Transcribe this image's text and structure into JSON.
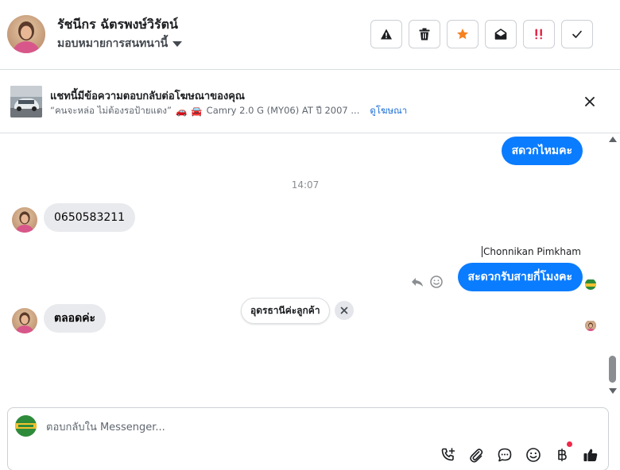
{
  "header": {
    "contact_name": "รัชนีกร ฉัตรพงษ์วิรัตน์",
    "assign_label": "มอบหมายการสนทนานี้",
    "actions": [
      {
        "name": "report-button",
        "icon": "warning-icon"
      },
      {
        "name": "delete-button",
        "icon": "trash-icon"
      },
      {
        "name": "star-button",
        "icon": "star-icon"
      },
      {
        "name": "mark-unread-button",
        "icon": "envelope-open-icon"
      },
      {
        "name": "follow-up-button",
        "icon": "double-exclamation-icon"
      },
      {
        "name": "mark-done-button",
        "icon": "checkmark-icon"
      }
    ]
  },
  "ad": {
    "title": "แชทนี้มีข้อความตอบกลับต่อโฆษณาของคุณ",
    "quote": "“คนจะหล่อ ไม่ต้องรอป้ายแดง”",
    "emoji_1": "🚗",
    "emoji_2": "🚘",
    "car_text": "Camry 2.0 G (MY06) AT ปี 2007 ...",
    "link": "ดูโฆษณา"
  },
  "messages": {
    "out_1": "สดวกไหมคะ",
    "timestamp": "14:07",
    "in_1": "0650583211",
    "sender_name": "Chonnikan Pimkham",
    "out_2": "สะดวกรับสายกี่โมงคะ",
    "in_2": "ตลอดค่ะ"
  },
  "quick_reply": {
    "label": "อุดรธานีค่ะลูกค้า"
  },
  "composer": {
    "placeholder": "ตอบกลับใน Messenger...",
    "tools": [
      "phone-plus-icon",
      "paperclip-icon",
      "chat-bubble-icon",
      "smiley-icon",
      "baht-icon",
      "thumbs-up-icon"
    ]
  },
  "colors": {
    "accent": "#0a7cff",
    "star": "#f5821f",
    "alert": "#e41e3f",
    "incoming_bubble": "#e9eaed"
  }
}
